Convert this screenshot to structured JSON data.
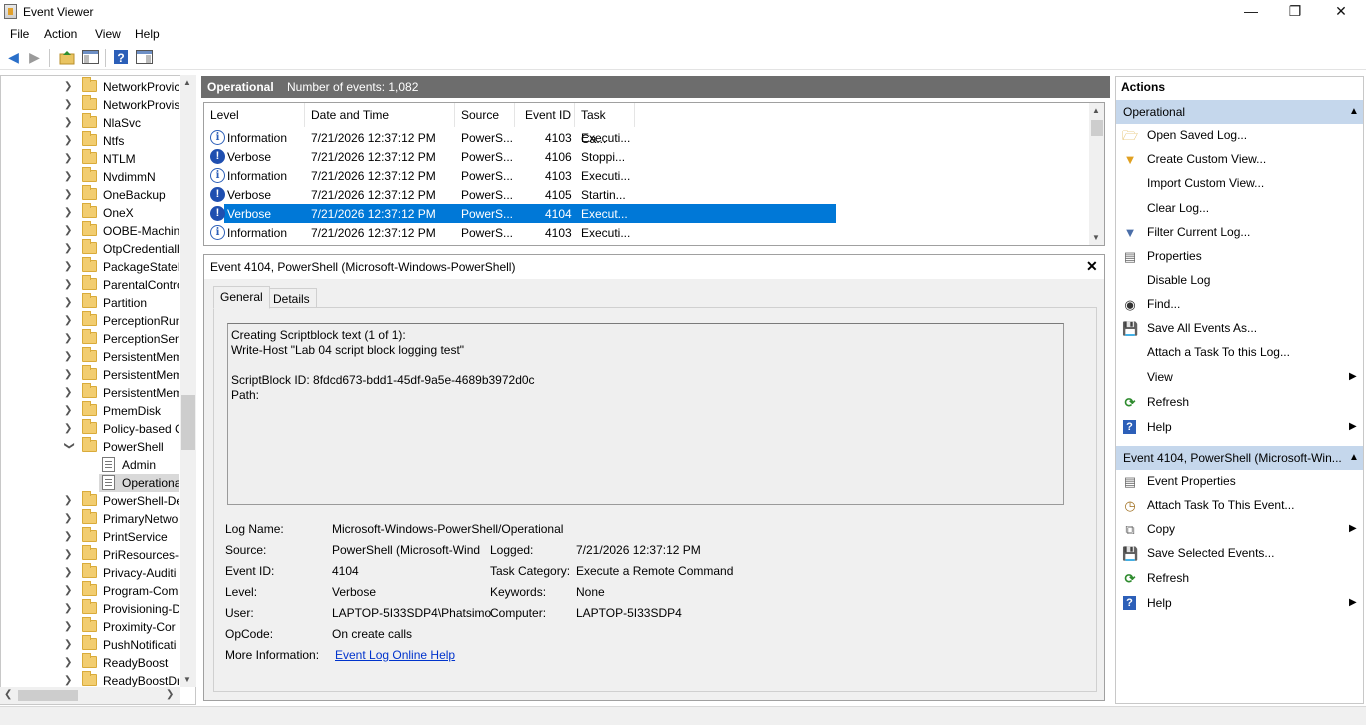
{
  "window": {
    "title": "Event Viewer",
    "minimize": "—",
    "maximize": "❐",
    "close": "✕"
  },
  "menu": [
    "File",
    "Action",
    "View",
    "Help"
  ],
  "toolbar": {
    "icons": [
      "back-arrow-icon",
      "forward-arrow-icon",
      "up-folder-icon",
      "show-hide-tree-icon",
      "help-icon",
      "show-hide-action-pane-icon"
    ]
  },
  "tree": {
    "items": [
      {
        "label": "NetworkProvic",
        "expanded": false
      },
      {
        "label": "NetworkProvis",
        "expanded": false
      },
      {
        "label": "NlaSvc",
        "expanded": false
      },
      {
        "label": "Ntfs",
        "expanded": false
      },
      {
        "label": "NTLM",
        "expanded": false
      },
      {
        "label": "NvdimmN",
        "expanded": false
      },
      {
        "label": "OneBackup",
        "expanded": false
      },
      {
        "label": "OneX",
        "expanded": false
      },
      {
        "label": "OOBE-Machin",
        "expanded": false
      },
      {
        "label": "OtpCredentiall",
        "expanded": false
      },
      {
        "label": "PackageStateR",
        "expanded": false
      },
      {
        "label": "ParentalContro",
        "expanded": false
      },
      {
        "label": "Partition",
        "expanded": false
      },
      {
        "label": "PerceptionRun",
        "expanded": false
      },
      {
        "label": "PerceptionSen",
        "expanded": false
      },
      {
        "label": "PersistentMem",
        "expanded": false
      },
      {
        "label": "PersistentMem",
        "expanded": false
      },
      {
        "label": "PersistentMem",
        "expanded": false
      },
      {
        "label": "PmemDisk",
        "expanded": false
      },
      {
        "label": "Policy-based C",
        "expanded": false
      },
      {
        "label": "PowerShell",
        "expanded": true
      },
      {
        "label": "PowerShell-De",
        "expanded": false
      },
      {
        "label": "PrimaryNetwo",
        "expanded": false
      },
      {
        "label": "PrintService",
        "expanded": false
      },
      {
        "label": "PriResources-D",
        "expanded": false
      },
      {
        "label": "Privacy-Auditi",
        "expanded": false
      },
      {
        "label": "Program-Com",
        "expanded": false
      },
      {
        "label": "Provisioning-D",
        "expanded": false
      },
      {
        "label": "Proximity-Cor",
        "expanded": false
      },
      {
        "label": "PushNotificati",
        "expanded": false
      },
      {
        "label": "ReadyBoost",
        "expanded": false
      },
      {
        "label": "ReadyBoostDri",
        "expanded": false
      }
    ],
    "powershell_children": [
      {
        "label": "Admin",
        "selected": false
      },
      {
        "label": "Operational",
        "selected": true
      }
    ]
  },
  "center": {
    "log_name": "Operational",
    "event_count_label": "Number of events: 1,082"
  },
  "event_list": {
    "columns": [
      "Level",
      "Date and Time",
      "Source",
      "Event ID",
      "Task Ca..."
    ],
    "rows": [
      {
        "level": "Information",
        "icon": "information-icon",
        "datetime": "7/21/2026 12:37:12 PM",
        "source": "PowerS...",
        "event_id": "4103",
        "task": "Executi...",
        "selected": false
      },
      {
        "level": "Verbose",
        "icon": "verbose-icon",
        "datetime": "7/21/2026 12:37:12 PM",
        "source": "PowerS...",
        "event_id": "4106",
        "task": "Stoppi...",
        "selected": false
      },
      {
        "level": "Information",
        "icon": "information-icon",
        "datetime": "7/21/2026 12:37:12 PM",
        "source": "PowerS...",
        "event_id": "4103",
        "task": "Executi...",
        "selected": false
      },
      {
        "level": "Verbose",
        "icon": "verbose-icon",
        "datetime": "7/21/2026 12:37:12 PM",
        "source": "PowerS...",
        "event_id": "4105",
        "task": "Startin...",
        "selected": false
      },
      {
        "level": "Verbose",
        "icon": "verbose-icon",
        "datetime": "7/21/2026 12:37:12 PM",
        "source": "PowerS...",
        "event_id": "4104",
        "task": "Execut...",
        "selected": true
      },
      {
        "level": "Information",
        "icon": "information-icon",
        "datetime": "7/21/2026 12:37:12 PM",
        "source": "PowerS...",
        "event_id": "4103",
        "task": "Executi...",
        "selected": false
      }
    ]
  },
  "detail": {
    "title": "Event 4104, PowerShell (Microsoft-Windows-PowerShell)",
    "tabs": [
      "General",
      "Details"
    ],
    "description": "Creating Scriptblock text (1 of 1):\nWrite-Host \"Lab 04 script block logging test\"\n\nScriptBlock ID: 8fdcd673-bdd1-45df-9a5e-4689b3972d0c\nPath:",
    "fields": {
      "log_name_label": "Log Name:",
      "log_name": "Microsoft-Windows-PowerShell/Operational",
      "source_label": "Source:",
      "source": "PowerShell (Microsoft-Wind",
      "logged_label": "Logged:",
      "logged": "7/21/2026 12:37:12 PM",
      "event_id_label": "Event ID:",
      "event_id": "4104",
      "task_category_label": "Task Category:",
      "task_category": "Execute a Remote Command",
      "level_label": "Level:",
      "level": "Verbose",
      "keywords_label": "Keywords:",
      "keywords": "None",
      "user_label": "User:",
      "user": "LAPTOP-5I33SDP4\\Phatsimo",
      "computer_label": "Computer:",
      "computer": "LAPTOP-5I33SDP4",
      "opcode_label": "OpCode:",
      "opcode": "On create calls",
      "more_info_label": "More Information:",
      "more_info_link": "Event Log Online Help"
    }
  },
  "actions": {
    "title": "Actions",
    "section1": {
      "title": "Operational",
      "items": [
        {
          "label": "Open Saved Log...",
          "icon": "open-folder-icon"
        },
        {
          "label": "Create Custom View...",
          "icon": "filter-icon"
        },
        {
          "label": "Import Custom View...",
          "icon": ""
        },
        {
          "label": "Clear Log...",
          "icon": ""
        },
        {
          "label": "Filter Current Log...",
          "icon": "filter-icon"
        },
        {
          "label": "Properties",
          "icon": "properties-icon"
        },
        {
          "label": "Disable Log",
          "icon": ""
        },
        {
          "label": "Find...",
          "icon": "binoculars-icon"
        },
        {
          "label": "Save All Events As...",
          "icon": "save-icon"
        },
        {
          "label": "Attach a Task To this Log...",
          "icon": ""
        },
        {
          "label": "View",
          "icon": "",
          "submenu": true
        },
        {
          "label": "Refresh",
          "icon": "refresh-icon"
        },
        {
          "label": "Help",
          "icon": "help-icon",
          "submenu": true
        }
      ]
    },
    "section2": {
      "title": "Event 4104, PowerShell (Microsoft-Win...",
      "items": [
        {
          "label": "Event Properties",
          "icon": "properties-icon"
        },
        {
          "label": "Attach Task To This Event...",
          "icon": "task-icon"
        },
        {
          "label": "Copy",
          "icon": "copy-icon",
          "submenu": true
        },
        {
          "label": "Save Selected Events...",
          "icon": "save-icon"
        },
        {
          "label": "Refresh",
          "icon": "refresh-icon"
        },
        {
          "label": "Help",
          "icon": "help-icon",
          "submenu": true
        }
      ]
    }
  }
}
